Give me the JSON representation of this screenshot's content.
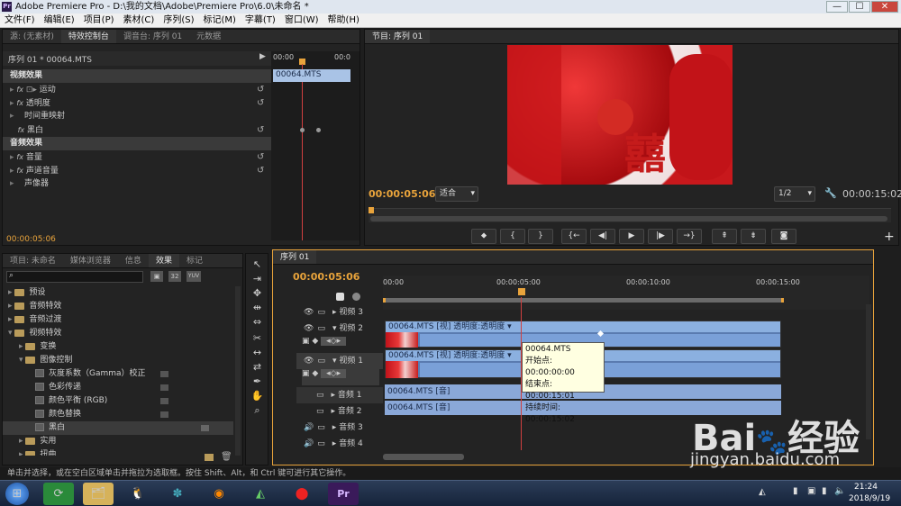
{
  "window": {
    "title": "Adobe Premiere Pro - D:\\我的文档\\Adobe\\Premiere Pro\\6.0\\未命名 *",
    "app_icon": "Pr",
    "controls": [
      "—",
      "☐",
      "✕"
    ]
  },
  "menu": [
    "文件(F)",
    "编辑(E)",
    "项目(P)",
    "素材(C)",
    "序列(S)",
    "标记(M)",
    "字幕(T)",
    "窗口(W)",
    "帮助(H)"
  ],
  "effect_controls": {
    "tabs": [
      "源: (无素材)",
      "特效控制台",
      "调音台: 序列 01",
      "元数据"
    ],
    "sequence_label": "序列 01 * 00064.MTS",
    "ruler_time": "00:00",
    "ruler_time2": "00:0",
    "clip_label": "00064.MTS",
    "video_header": "视频效果",
    "video_rows": [
      "运动",
      "透明度",
      "时间重映射",
      "黑白"
    ],
    "audio_header": "音频效果",
    "audio_rows": [
      "音量",
      "声道音量",
      "声像器"
    ],
    "timecode": "00:00:05:06",
    "fx_label": "fx"
  },
  "program": {
    "tab": "节目: 序列 01",
    "timecode": "00:00:05:06",
    "fit": "适合",
    "resolution": "1/2",
    "duration": "00:00:15:02",
    "frame_text": "囍"
  },
  "project": {
    "tabs": [
      "项目: 未命名",
      "媒体浏览器",
      "信息",
      "效果",
      "标记"
    ],
    "search_placeholder": "",
    "badges": [
      "32",
      "YUV"
    ],
    "tree": [
      {
        "label": "预设",
        "level": 0
      },
      {
        "label": "音频特效",
        "level": 0
      },
      {
        "label": "音频过渡",
        "level": 0
      },
      {
        "label": "视频特效",
        "level": 0
      },
      {
        "label": "变换",
        "level": 1
      },
      {
        "label": "图像控制",
        "level": 1
      },
      {
        "label": "灰度系数（Gamma）校正",
        "level": 2
      },
      {
        "label": "色彩传递",
        "level": 2
      },
      {
        "label": "颜色平衡 (RGB)",
        "level": 2
      },
      {
        "label": "颜色替换",
        "level": 2
      },
      {
        "label": "黑白",
        "level": 2
      },
      {
        "label": "实用",
        "level": 1
      },
      {
        "label": "扭曲",
        "level": 1
      }
    ]
  },
  "timeline": {
    "tab": "序列 01",
    "timecode": "00:00:05:06",
    "ruler": [
      "00:00",
      "00:00:05:00",
      "00:00:10:00",
      "00:00:15:00"
    ],
    "tracks": [
      {
        "label": "视频 3"
      },
      {
        "label": "视频 2"
      },
      {
        "label": "视频 1"
      },
      {
        "label": "音频 1"
      },
      {
        "label": "音频 2"
      },
      {
        "label": "音频 3"
      },
      {
        "label": "音频 4"
      }
    ],
    "clip_v2": "00064.MTS [视] 透明度:透明度 ▾",
    "clip_v1": "00064.MTS [视] 透明度:透明度 ▾",
    "clip_a1": "00064.MTS [音]",
    "clip_a2": "00064.MTS [音]",
    "tooltip": {
      "name": "00064.MTS",
      "start": "开始点: 00:00:00:00",
      "end": "结束点: 00:00:15:01",
      "dur": "持续时间: 00:00:15:02"
    }
  },
  "status": "单击并选择，或在空白区域单击并拖拉为选取框。按住 Shift、Alt，和 Ctrl 键可进行其它操作。",
  "watermark": {
    "brand": "Bai",
    "brand2": "经验",
    "url": "jingyan.baidu.com"
  },
  "taskbar": {
    "time": "21:24",
    "date": "2018/9/19"
  },
  "colors": {
    "accent": "#e8a33b",
    "clip_video": "#8bb0e0",
    "playhead": "#d04040"
  }
}
